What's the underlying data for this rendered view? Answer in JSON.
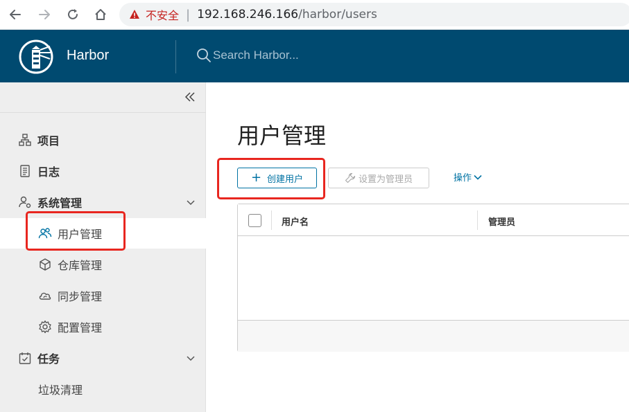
{
  "browser": {
    "security_label": "不安全",
    "url_host": "192.168.246.166",
    "url_path": "/harbor/users"
  },
  "header": {
    "brand": "Harbor",
    "search_placeholder": "Search Harbor..."
  },
  "sidebar": {
    "items": [
      {
        "label": "项目",
        "icon": "project-icon"
      },
      {
        "label": "日志",
        "icon": "log-icon"
      },
      {
        "label": "系统管理",
        "icon": "admin-icon"
      },
      {
        "label": "用户管理",
        "icon": "users-icon",
        "active": true
      },
      {
        "label": "仓库管理",
        "icon": "box-icon"
      },
      {
        "label": "同步管理",
        "icon": "cloud-sync-icon"
      },
      {
        "label": "配置管理",
        "icon": "gear-icon"
      },
      {
        "label": "任务",
        "icon": "calendar-check-icon"
      },
      {
        "label": "垃圾清理"
      }
    ]
  },
  "main": {
    "title": "用户管理",
    "toolbar": {
      "create_plus": "+",
      "create_label": "创建用户",
      "set_admin_label": "设置为管理员",
      "action_label": "操作"
    },
    "grid": {
      "columns": [
        "用户名",
        "管理员"
      ]
    }
  },
  "colors": {
    "header_bg": "#004a70",
    "accent": "#0072a3",
    "annotation": "#e8261f",
    "sidebar_bg": "#eeeeee"
  }
}
